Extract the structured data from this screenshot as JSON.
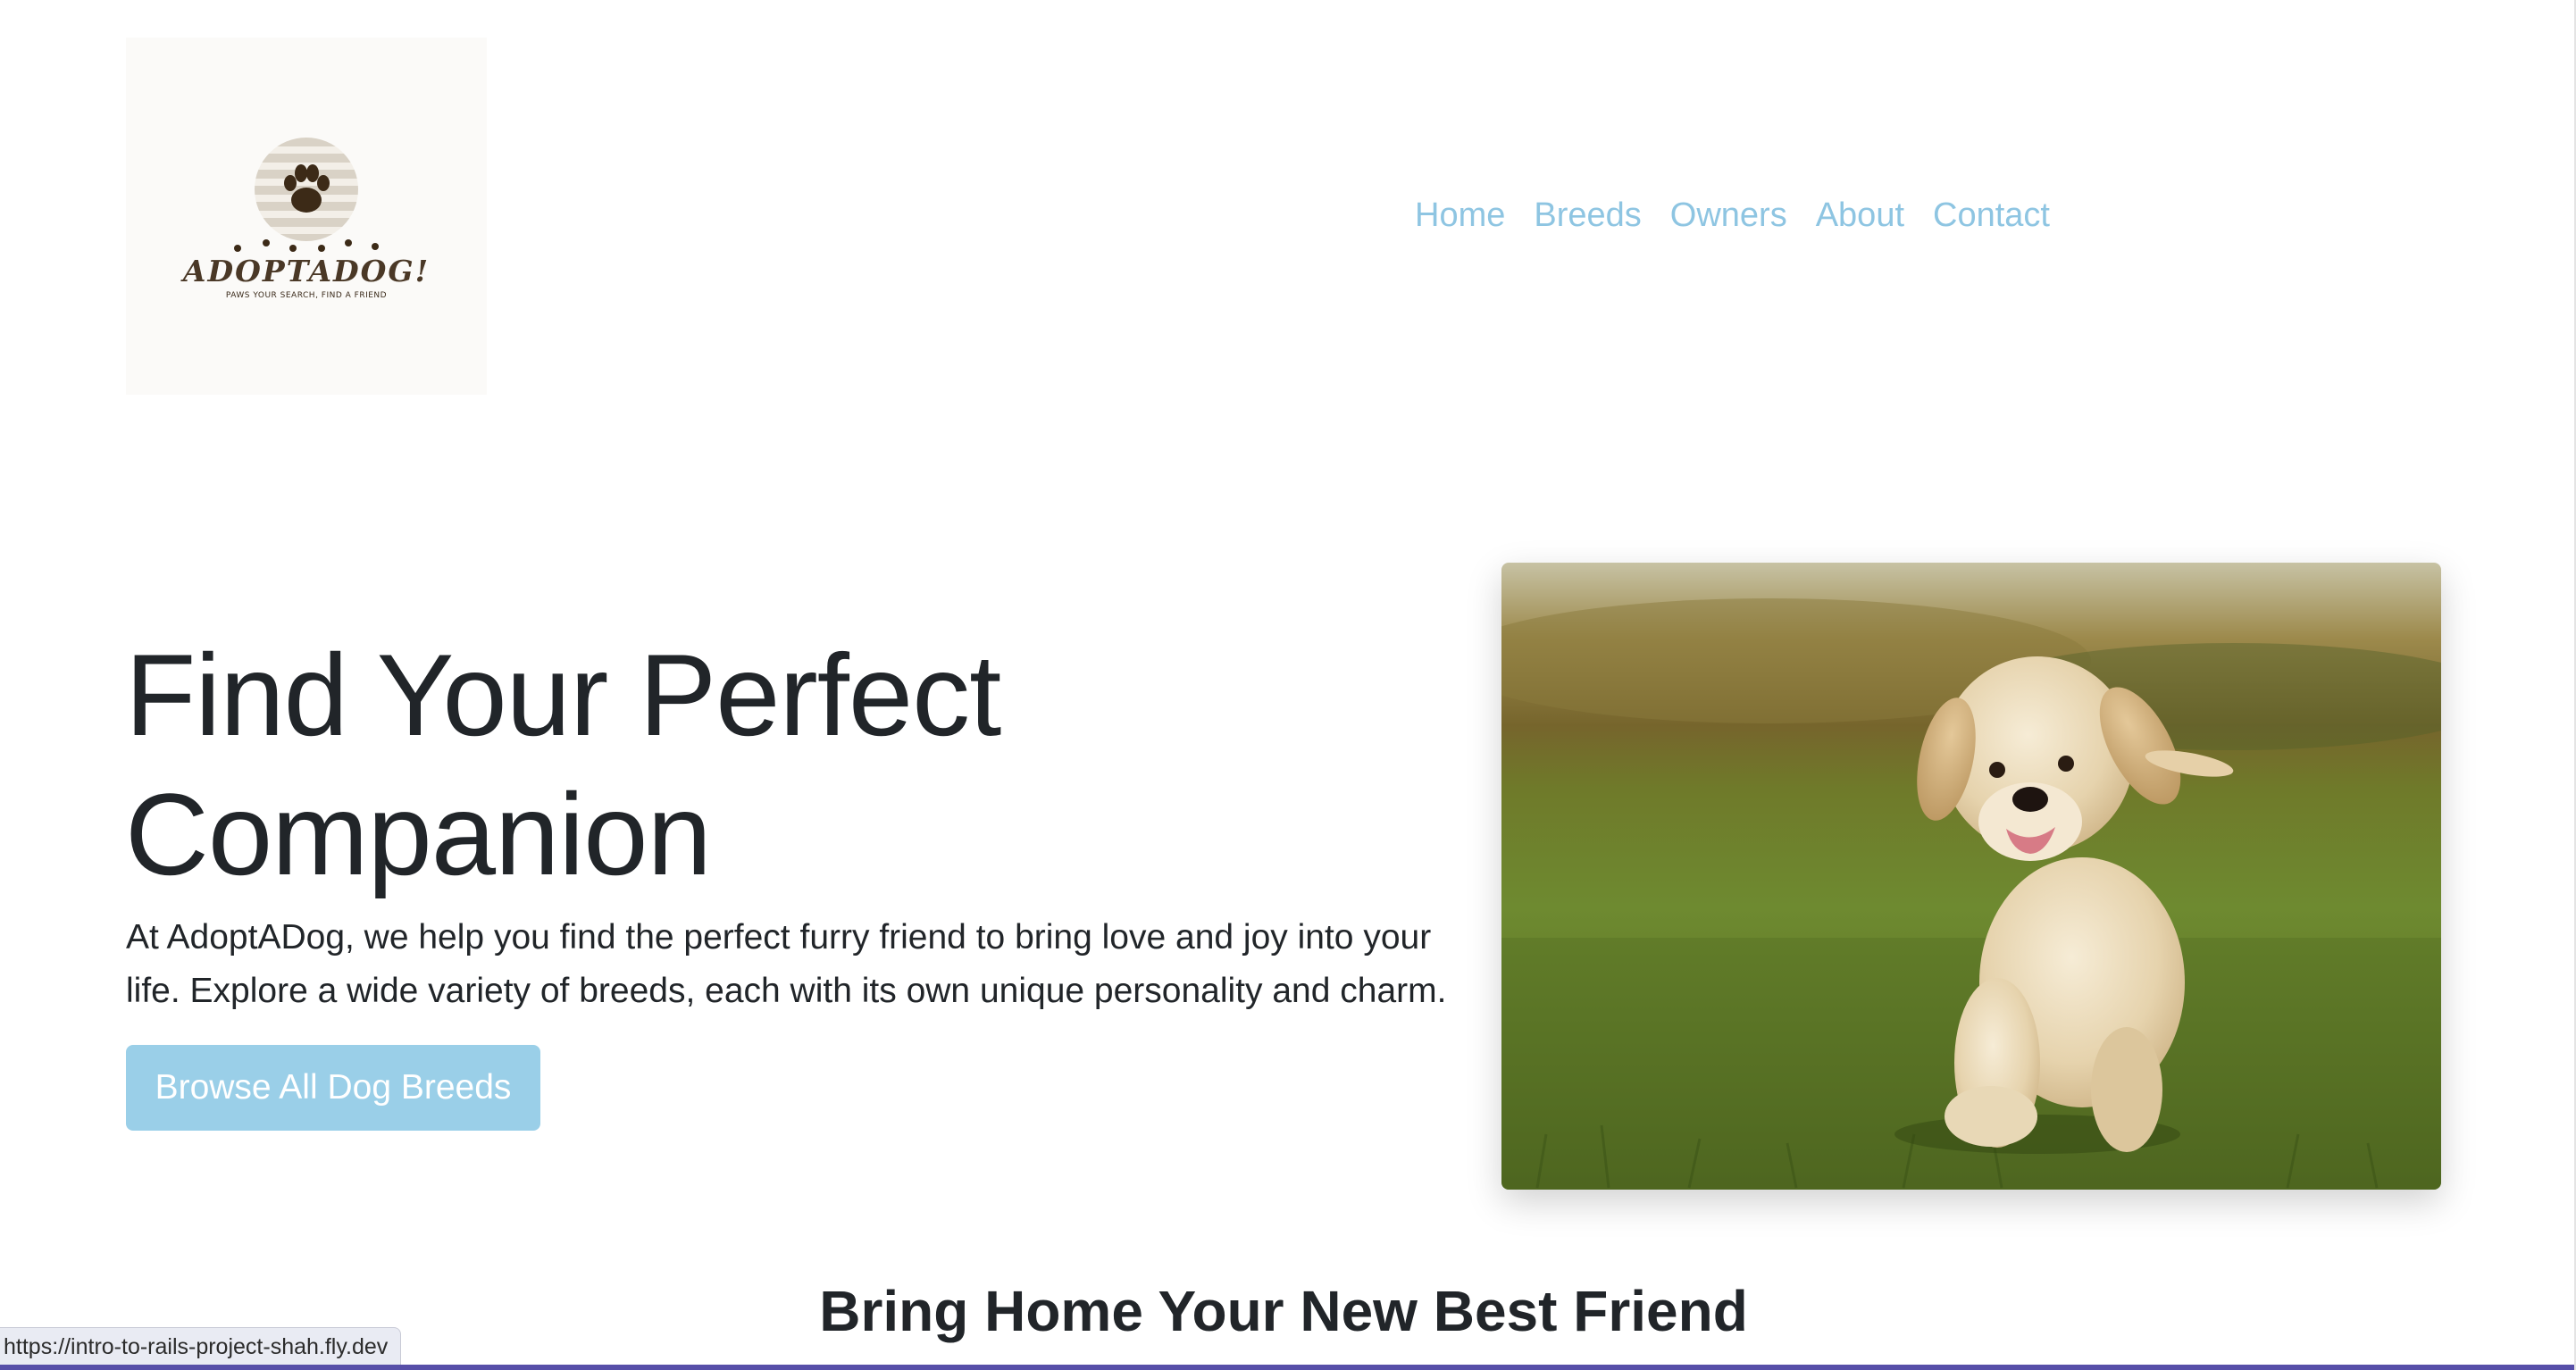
{
  "header": {
    "logo": {
      "name": "ADOPTADOG!",
      "tagline": "PAWS YOUR SEARCH, FIND A FRIEND"
    },
    "nav": [
      "Home",
      "Breeds",
      "Owners",
      "About",
      "Contact"
    ]
  },
  "hero": {
    "title_line1": "Find Your Perfect",
    "title_line2": "Companion",
    "text": "At AdoptADog, we help you find the perfect furry friend to bring love and joy into your life. Explore a wide variety of breeds, each with its own unique personality and charm.",
    "button_label": "Browse All Dog Breeds",
    "image_icon": "puppy-photo"
  },
  "section": {
    "heading": "Bring Home Your New Best Friend"
  },
  "status_bar": {
    "url": "https://intro-to-rails-project-shah.fly.dev"
  },
  "colors": {
    "accent": "#8ec5e2",
    "button": "#9acfe8",
    "text": "#212529",
    "logo_brown": "#4a3826"
  }
}
